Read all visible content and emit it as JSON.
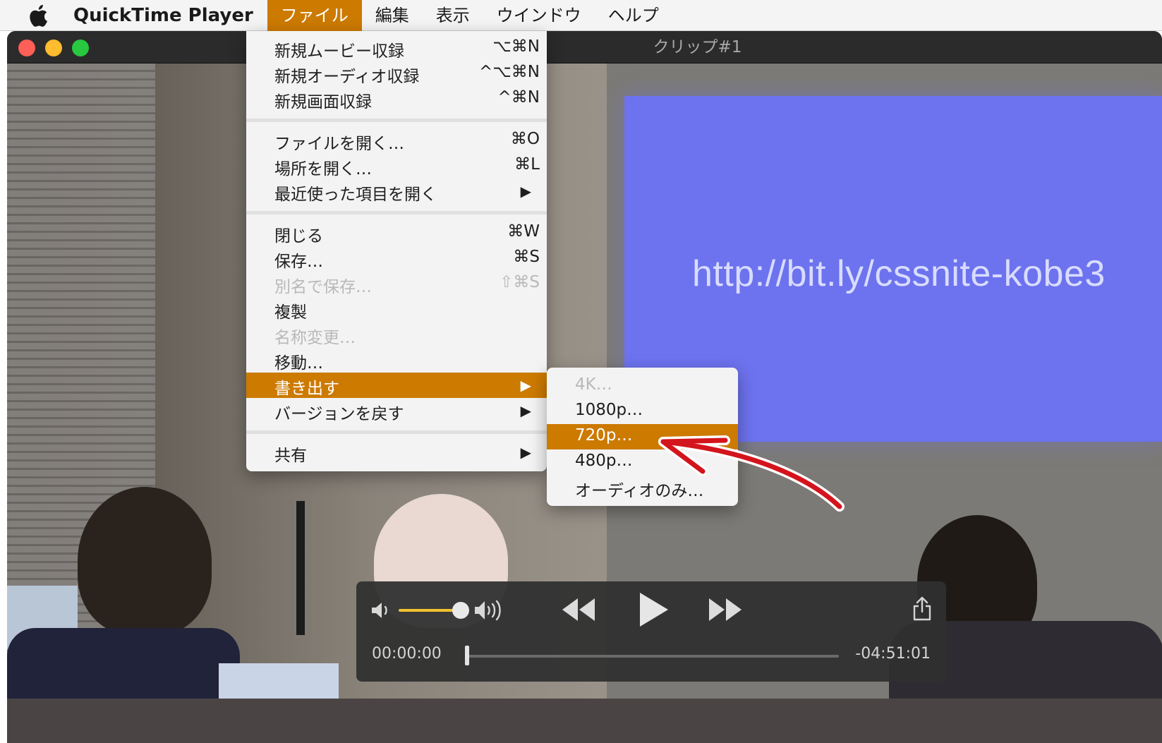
{
  "menubar": {
    "app_name": "QuickTime Player",
    "items": [
      "ファイル",
      "編集",
      "表示",
      "ウインドウ",
      "ヘルプ"
    ],
    "active_item": "ファイル"
  },
  "window": {
    "title": "クリップ#1"
  },
  "video": {
    "projection_text": "http://bit.ly/cssnite-kobe3"
  },
  "player": {
    "time_current": "00:00:00",
    "time_remaining": "-04:51:01",
    "volume_level": 0.85,
    "playback_position": 0.0
  },
  "file_menu": {
    "items": [
      {
        "label": "新規ムービー収録",
        "shortcut": "⌥⌘N"
      },
      {
        "label": "新規オーディオ収録",
        "shortcut": "^⌥⌘N"
      },
      {
        "label": "新規画面収録",
        "shortcut": "^⌘N"
      },
      {
        "label": "ファイルを開く…",
        "shortcut": "⌘O"
      },
      {
        "label": "場所を開く…",
        "shortcut": "⌘L"
      },
      {
        "label": "最近使った項目を開く",
        "shortcut": "▶"
      },
      {
        "label": "閉じる",
        "shortcut": "⌘W"
      },
      {
        "label": "保存…",
        "shortcut": "⌘S"
      },
      {
        "label": "別名で保存…",
        "shortcut": "⇧⌘S",
        "disabled": true
      },
      {
        "label": "複製",
        "shortcut": ""
      },
      {
        "label": "名称変更…",
        "shortcut": "",
        "disabled": true
      },
      {
        "label": "移動…",
        "shortcut": ""
      },
      {
        "label": "書き出す",
        "shortcut": "▶",
        "highlighted": true
      },
      {
        "label": "バージョンを戻す",
        "shortcut": "▶"
      },
      {
        "label": "共有",
        "shortcut": "▶"
      }
    ]
  },
  "export_submenu": {
    "items": [
      {
        "label": "4K…",
        "disabled": true
      },
      {
        "label": "1080p…"
      },
      {
        "label": "720p…",
        "highlighted": true
      },
      {
        "label": "480p…"
      },
      {
        "label": "オーディオのみ…"
      }
    ]
  },
  "colors": {
    "menu_highlight": "#cc7a00",
    "volume_accent": "#f2c230",
    "annotation_arrow": "#d4141c"
  },
  "icons": [
    "apple-logo-icon",
    "volume-low-icon",
    "volume-high-icon",
    "rewind-icon",
    "play-icon",
    "fast-forward-icon",
    "share-icon",
    "submenu-arrow-icon"
  ]
}
